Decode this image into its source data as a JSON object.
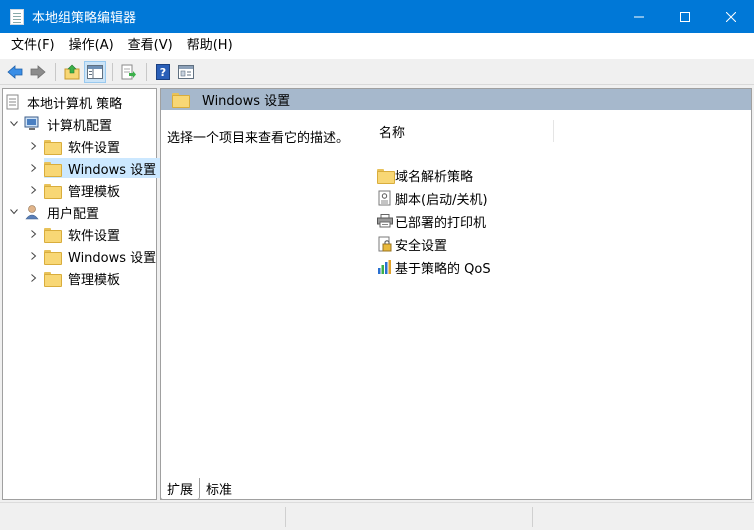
{
  "window": {
    "title": "本地组策略编辑器"
  },
  "menu": [
    "文件(F)",
    "操作(A)",
    "查看(V)",
    "帮助(H)"
  ],
  "toolbar": {
    "icons": [
      "back-arrow-icon",
      "forward-arrow-icon",
      "up-folder-icon",
      "show-hide-tree-icon",
      "export-list-icon",
      "help-icon",
      "properties-icon"
    ]
  },
  "tree": {
    "root": "本地计算机 策略",
    "computer_config": "计算机配置",
    "computer_children": [
      "软件设置",
      "Windows 设置",
      "管理模板"
    ],
    "user_config": "用户配置",
    "user_children": [
      "软件设置",
      "Windows 设置",
      "管理模板"
    ],
    "selected": "计算机配置 > Windows 设置"
  },
  "details": {
    "header": "Windows 设置",
    "description": "选择一个项目来查看它的描述。",
    "column_name": "名称",
    "items": [
      {
        "label": "域名解析策略",
        "icon": "folder-icon"
      },
      {
        "label": "脚本(启动/关机)",
        "icon": "script-icon"
      },
      {
        "label": "已部署的打印机",
        "icon": "printer-icon"
      },
      {
        "label": "安全设置",
        "icon": "security-icon"
      },
      {
        "label": "基于策略的 QoS",
        "icon": "qos-chart-icon"
      }
    ]
  },
  "tabs": [
    "扩展",
    "标准"
  ],
  "colors": {
    "titlebar": "#0078d7",
    "selection": "#cce8ff",
    "header_band": "#a6b8cc"
  }
}
